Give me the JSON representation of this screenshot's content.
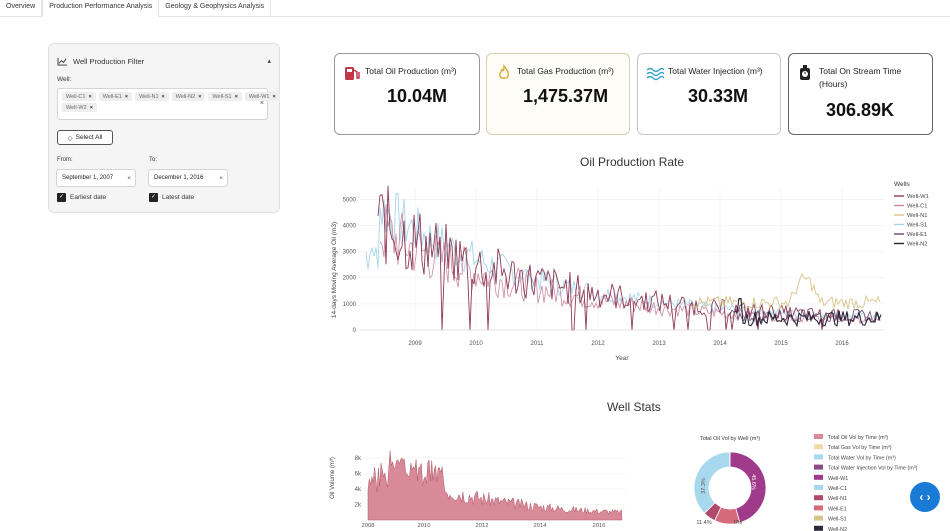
{
  "tabs": [
    {
      "label": "Overview"
    },
    {
      "label": "Production Performance Analysis"
    },
    {
      "label": "Geology & Geophysics Analysis"
    }
  ],
  "filter": {
    "title": "Well Production Filter",
    "well_label": "Well:",
    "wells": [
      "Well-C1",
      "Well-E1",
      "Well-N1",
      "Well-N2",
      "Well-S1",
      "Well-W1",
      "Well-W2"
    ],
    "select_all_label": "Select All",
    "from_label": "From:",
    "to_label": "To:",
    "from_value": "September 1, 2007",
    "to_value": "December 1, 2016",
    "earliest_label": "Earliest date",
    "latest_label": "Latest date"
  },
  "kpis": [
    {
      "title": "Total Oil Production (m³)",
      "value": "10.04M",
      "icon": "oil-pump-icon",
      "color": "#c0394b"
    },
    {
      "title": "Total Gas Production (m³)",
      "value": "1,475.37M",
      "icon": "flame-icon",
      "color": "#d8a93a"
    },
    {
      "title": "Total Water Injection (m³)",
      "value": "30.33M",
      "icon": "water-waves-icon",
      "color": "#3aa6c9"
    },
    {
      "title": "Total On Stream Time (Hours)",
      "value": "306.89K",
      "icon": "clock-icon",
      "color": "#222222"
    }
  ],
  "oil_rate": {
    "title": "Oil Production Rate",
    "ylabel": "14-days Moving Average Oil (m3)",
    "xlabel": "Year",
    "yticks": [
      "0",
      "1000",
      "2000",
      "3000",
      "4000",
      "5000"
    ],
    "xticks": [
      "2009",
      "2010",
      "2011",
      "2012",
      "2013",
      "2014",
      "2015",
      "2016"
    ],
    "legend_title": "Wells",
    "legend": [
      {
        "name": "Well-W1",
        "color": "#8e3a57"
      },
      {
        "name": "Well-C1",
        "color": "#c98aa0"
      },
      {
        "name": "Well-N1",
        "color": "#d8c48a"
      },
      {
        "name": "Well-S1",
        "color": "#a5d6e8"
      },
      {
        "name": "Well-E1",
        "color": "#6a4a6a"
      },
      {
        "name": "Well-N2",
        "color": "#2a2238"
      }
    ]
  },
  "well_stats": {
    "title": "Well Stats",
    "ylabel": "Oil Volume (m³)",
    "yticks": [
      "2k",
      "4k",
      "6k",
      "8k"
    ],
    "xticks": [
      "2008",
      "2010",
      "2012",
      "2014",
      "2016"
    ],
    "donut_title": "Total Oil Vol by Well (m³)",
    "donut_labels": [
      "45.6%",
      "37.3%",
      "11.4%",
      "0%"
    ],
    "legend": [
      {
        "name": "Total Oil Vol by Time (m³)",
        "color": "#d98a98"
      },
      {
        "name": "Total Gas Vol by Time (m³)",
        "color": "#efdba8"
      },
      {
        "name": "Total Water Vol by Time (m³)",
        "color": "#a8d8ee"
      },
      {
        "name": "Total Water Injection Vol by Time (m³)",
        "color": "#8a4a8a"
      },
      {
        "name": "Well-W1",
        "color": "#a03a8a"
      },
      {
        "name": "Well-C1",
        "color": "#a8d8ee"
      },
      {
        "name": "Well-N1",
        "color": "#b04a6a"
      },
      {
        "name": "Well-E1",
        "color": "#d46a7a"
      },
      {
        "name": "Well-S1",
        "color": "#d8c48a"
      },
      {
        "name": "Well-N2",
        "color": "#2a2a3a"
      }
    ]
  },
  "fab_label": "‹ ›"
}
